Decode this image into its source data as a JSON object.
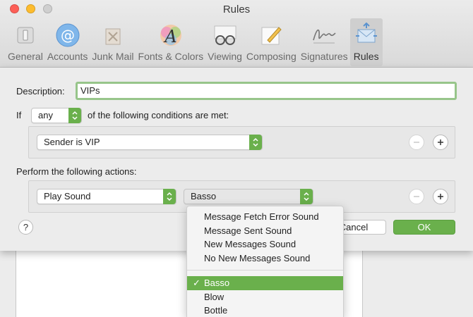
{
  "window": {
    "title": "Rules"
  },
  "toolbar": {
    "items": [
      {
        "label": "General",
        "icon": "general-switch-icon"
      },
      {
        "label": "Accounts",
        "icon": "at-sign-icon"
      },
      {
        "label": "Junk Mail",
        "icon": "junk-bin-icon"
      },
      {
        "label": "Fonts & Colors",
        "icon": "fonts-colors-icon"
      },
      {
        "label": "Viewing",
        "icon": "glasses-icon"
      },
      {
        "label": "Composing",
        "icon": "pencil-paper-icon"
      },
      {
        "label": "Signatures",
        "icon": "signature-icon"
      },
      {
        "label": "Rules",
        "icon": "rules-envelope-icon"
      }
    ],
    "selected": "Rules"
  },
  "rule": {
    "description_label": "Description:",
    "description_value": "VIPs",
    "if_label": "If",
    "match_value": "any",
    "conditions_suffix": "of the following conditions are met:",
    "condition_value": "Sender is VIP",
    "actions_label": "Perform the following actions:",
    "action_value": "Play Sound",
    "sound_value": "Basso"
  },
  "buttons": {
    "help": "?",
    "cancel": "Cancel",
    "ok": "OK"
  },
  "sound_menu": {
    "special_items": [
      "Message Fetch Error Sound",
      "Message Sent Sound",
      "New Messages Sound",
      "No New Messages Sound"
    ],
    "items": [
      "Basso",
      "Blow",
      "Bottle"
    ],
    "selected": "Basso",
    "check": "✓"
  },
  "colors": {
    "accent_green": "#6ab04c",
    "focus_ring": "#97c58a"
  }
}
